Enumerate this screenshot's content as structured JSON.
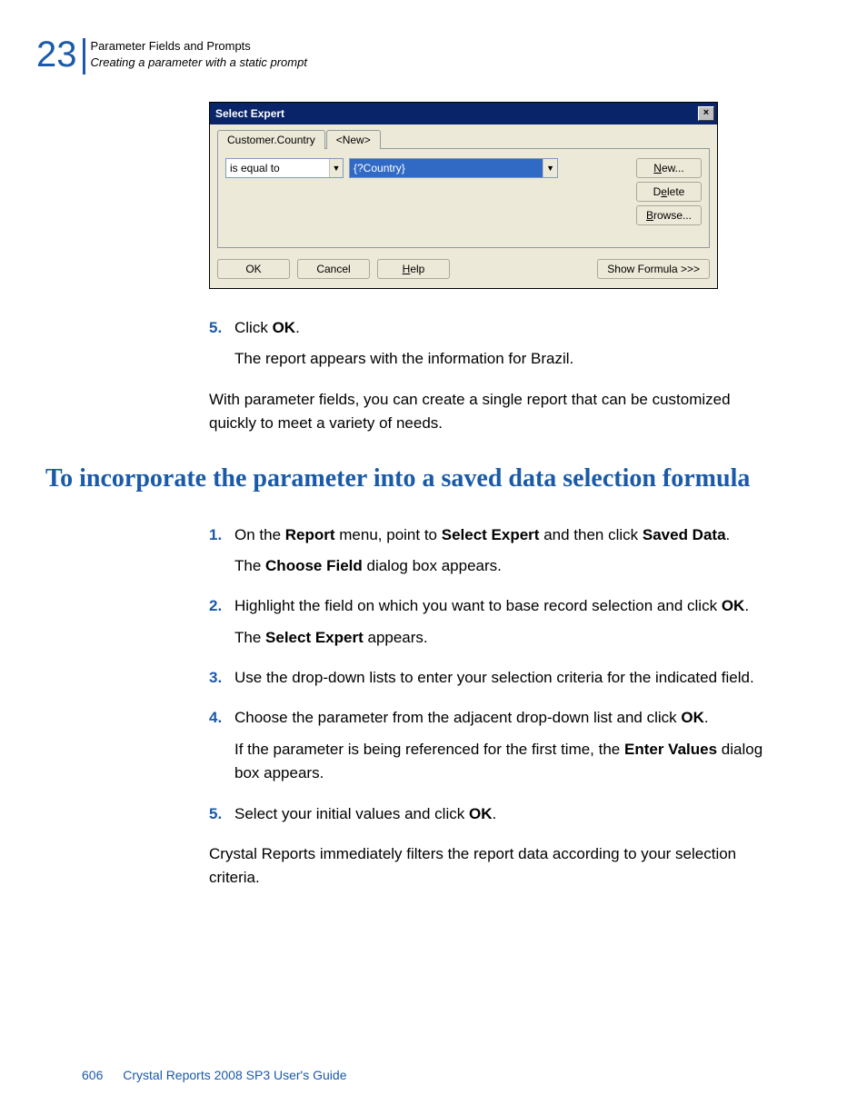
{
  "header": {
    "chapter_number": "23",
    "line1": "Parameter Fields and Prompts",
    "line2": "Creating a parameter with a static prompt"
  },
  "dialog": {
    "title": "Select Expert",
    "close_x": "×",
    "tabs": {
      "active": "Customer.Country",
      "new": "<New>"
    },
    "combo_left_value": "is equal to",
    "combo_right_value": "{?Country}",
    "arrow": "▼",
    "buttons": {
      "new": "New...",
      "delete": "Delete",
      "browse": "Browse...",
      "ok": "OK",
      "cancel": "Cancel",
      "help": "Help",
      "show_formula": "Show Formula >>>"
    },
    "underlines": {
      "n": "N",
      "e": "e",
      "b": "B",
      "h": "H"
    }
  },
  "body": {
    "step5_num": "5.",
    "step5_a": "Click ",
    "step5_b": "OK",
    "step5_c": ".",
    "step5_result": "The report appears with the information for Brazil.",
    "para1": "With parameter fields, you can create a single report that can be customized quickly to meet a variety of needs."
  },
  "heading": "To incorporate the parameter into a saved data selection formula",
  "steps": {
    "s1_num": "1.",
    "s1_a": "On the ",
    "s1_b": "Report",
    "s1_c": " menu, point to ",
    "s1_d": "Select Expert",
    "s1_e": " and then click ",
    "s1_f": "Saved Data",
    "s1_g": ".",
    "s1_r_a": "The ",
    "s1_r_b": "Choose Field",
    "s1_r_c": " dialog box appears.",
    "s2_num": "2.",
    "s2_a": "Highlight the field on which you want to base record selection and click ",
    "s2_b": "OK",
    "s2_c": ".",
    "s2_r_a": "The ",
    "s2_r_b": "Select Expert",
    "s2_r_c": " appears.",
    "s3_num": "3.",
    "s3_text": "Use the drop-down lists to enter your selection criteria for the indicated field.",
    "s4_num": "4.",
    "s4_a": "Choose the parameter from the adjacent drop-down list and click ",
    "s4_b": "OK",
    "s4_c": ".",
    "s4_r_a": "If the parameter is being referenced for the first time, the ",
    "s4_r_b": "Enter Values",
    "s4_r_c": " dialog box appears.",
    "s5_num": "5.",
    "s5_a": "Select your initial values and click ",
    "s5_b": "OK",
    "s5_c": ".",
    "final": "Crystal Reports immediately filters the report data according to your selection criteria."
  },
  "footer": {
    "page": "606",
    "guide": "Crystal Reports 2008 SP3 User's Guide"
  }
}
